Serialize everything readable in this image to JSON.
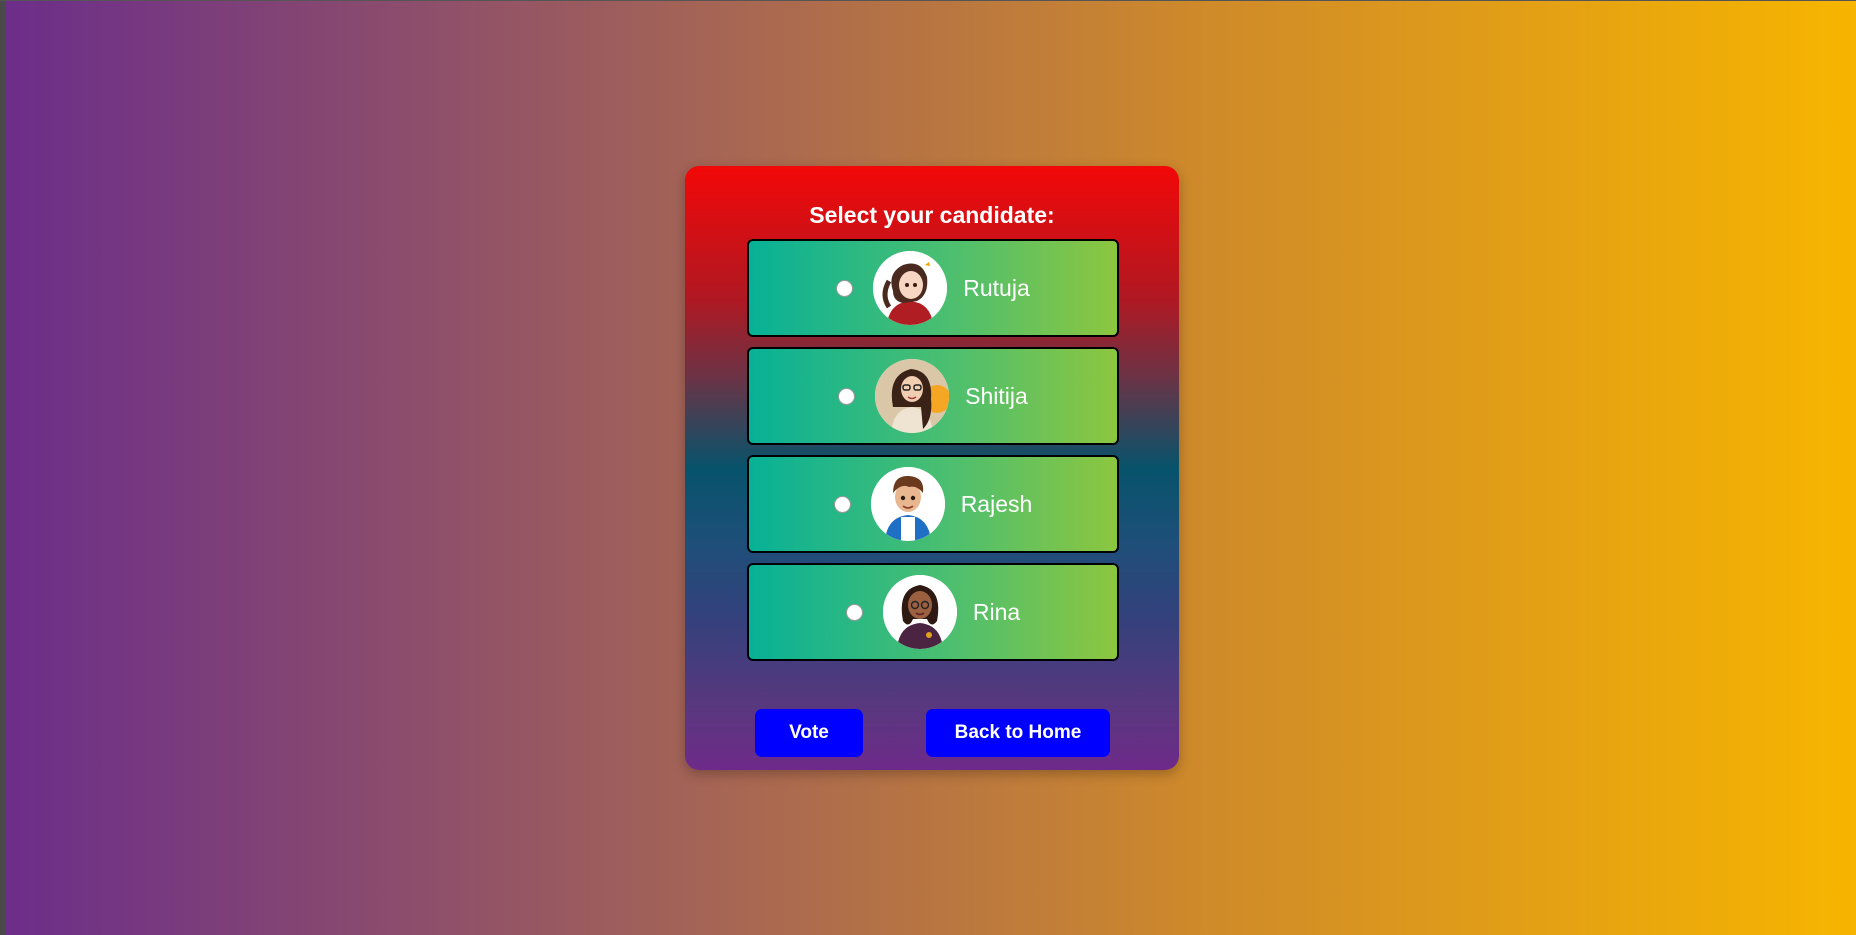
{
  "form": {
    "title": "Select your candidate:",
    "candidates": [
      {
        "name": "Rutuja",
        "avatar": "cartoon-girl-red-hoodie-avatar",
        "selected": false
      },
      {
        "name": "Shitija",
        "avatar": "cartoon-woman-glasses-avatar",
        "selected": false
      },
      {
        "name": "Rajesh",
        "avatar": "cartoon-boy-backpack-avatar",
        "selected": false
      },
      {
        "name": "Rina",
        "avatar": "cartoon-woman-blazer-avatar",
        "selected": false
      }
    ],
    "vote_label": "Vote",
    "home_label": "Back to Home"
  },
  "colors": {
    "button": "#0000ff",
    "card_top": "#f20808",
    "card_bottom": "#6e2a8a",
    "option_left": "#07b197",
    "option_right": "#8cc63f"
  }
}
